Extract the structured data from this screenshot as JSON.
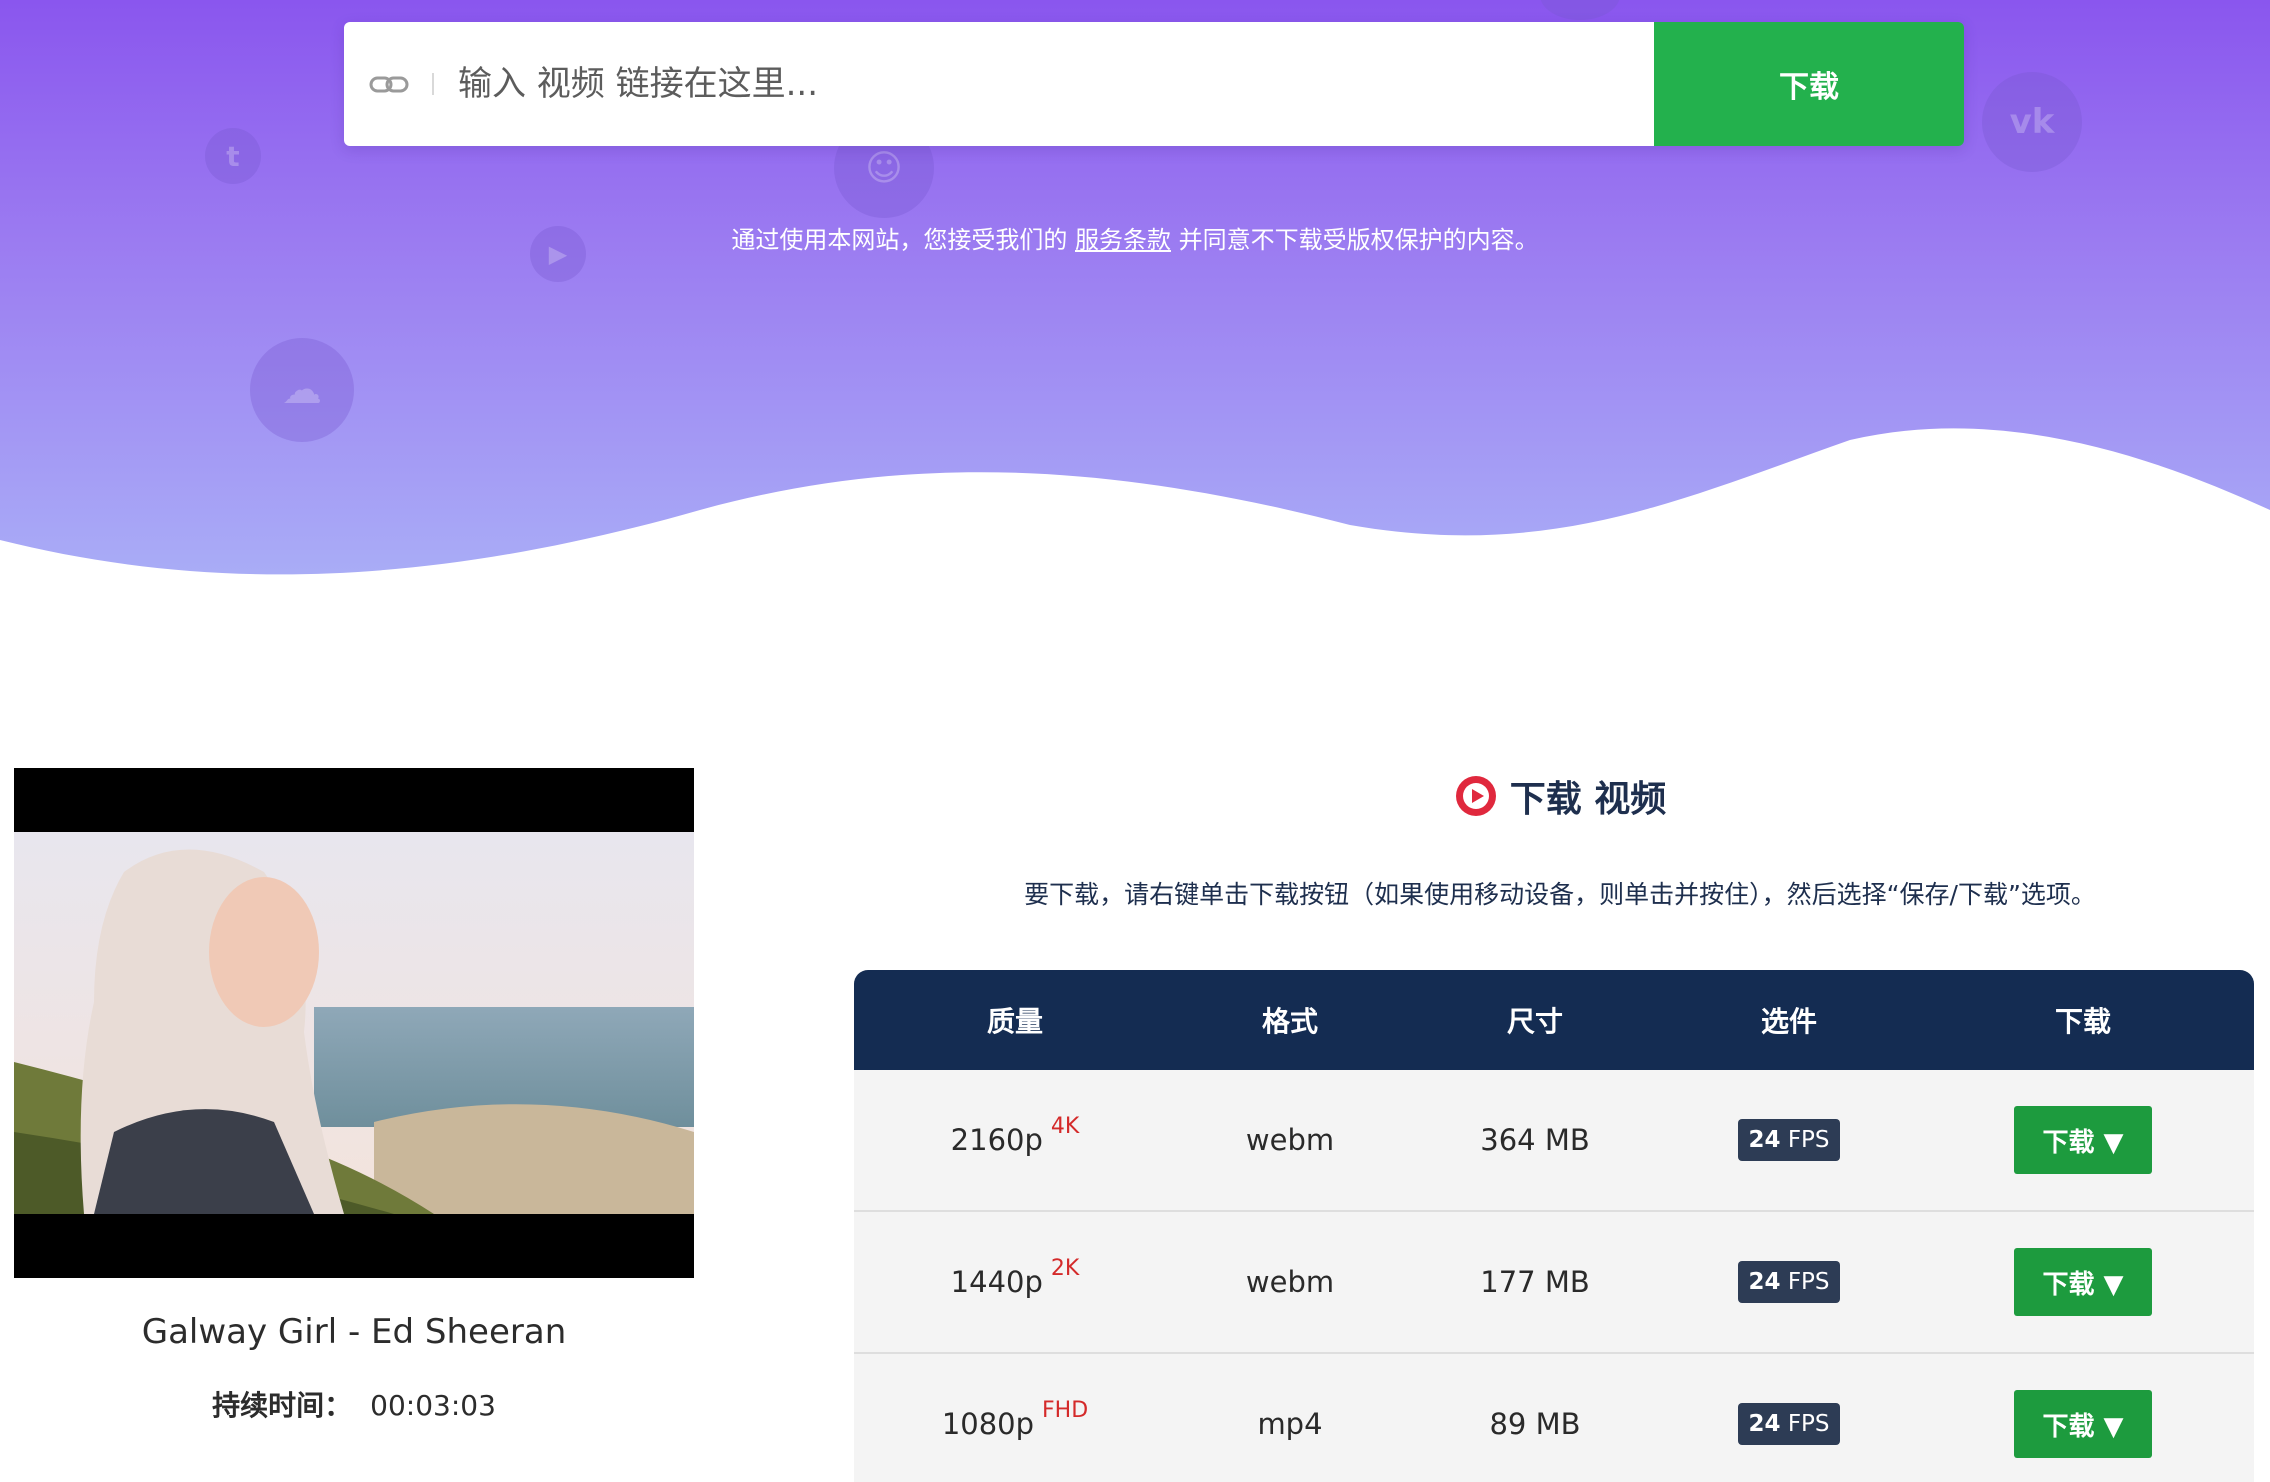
{
  "search": {
    "placeholder": "输入 视频 链接在这里...",
    "button_label": "下载"
  },
  "terms": {
    "prefix": "通过使用本网站，您接受我们的 ",
    "link": "服务条款",
    "suffix": " 并同意不下载受版权保护的内容。"
  },
  "video": {
    "title": "Galway Girl - Ed Sheeran",
    "duration_label": "持续时间：",
    "duration_value": "00:03:03"
  },
  "download": {
    "heading": "下载 视频",
    "instructions": "要下载，请右键单击下载按钮（如果使用移动设备，则单击并按住），然后选择“保存/下载”选项。",
    "columns": [
      "质量",
      "格式",
      "尺寸",
      "选件",
      "下载"
    ],
    "rows": [
      {
        "quality": "2160p",
        "tag": "4K",
        "format": "webm",
        "size": "364 MB",
        "fps_num": "24",
        "fps_unit": "FPS",
        "button": "下载 ▼"
      },
      {
        "quality": "1440p",
        "tag": "2K",
        "format": "webm",
        "size": "177 MB",
        "fps_num": "24",
        "fps_unit": "FPS",
        "button": "下载 ▼"
      },
      {
        "quality": "1080p",
        "tag": "FHD",
        "format": "mp4",
        "size": "89 MB",
        "fps_num": "24",
        "fps_unit": "FPS",
        "button": "下载 ▼"
      }
    ]
  },
  "colors": {
    "hero_top": "#8a56ee",
    "hero_bottom": "#aab0f7",
    "accent_green": "#23b14d",
    "table_header": "#142c52",
    "tag_red": "#d42a2a",
    "play_red": "#e0283d"
  },
  "icons": [
    "link-icon",
    "play-circle-icon",
    "twitter-icon",
    "vk-icon",
    "cloud-icon",
    "youtube-icon",
    "twitch-icon"
  ]
}
